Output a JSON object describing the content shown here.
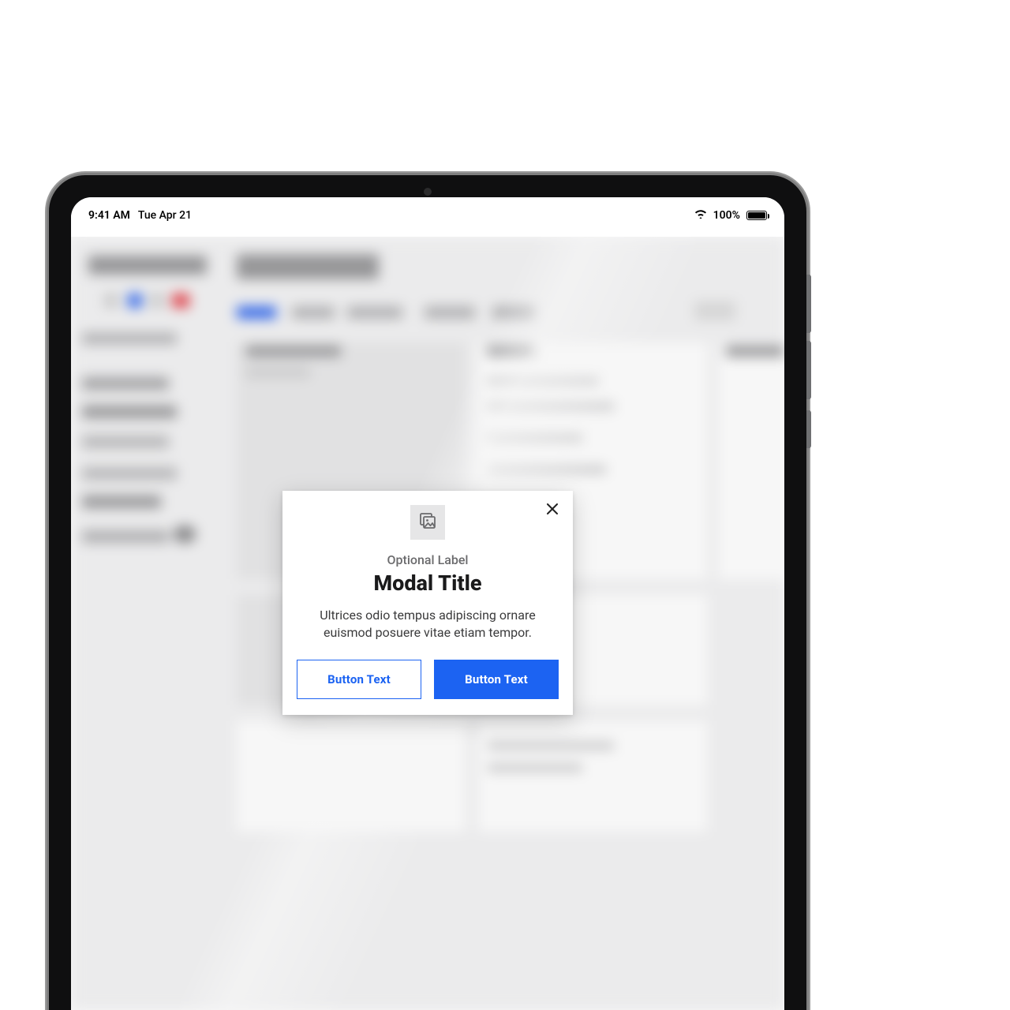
{
  "statusbar": {
    "time": "9:41 AM",
    "date": "Tue Apr 21",
    "battery_pct": "100%"
  },
  "modal": {
    "label": "Optional Label",
    "title": "Modal Title",
    "body": "Ultrices odio tempus adipiscing ornare euismod posuere vitae etiam tempor.",
    "secondary_button": "Button Text",
    "primary_button": "Button Text"
  },
  "colors": {
    "accent": "#1c63f2"
  }
}
